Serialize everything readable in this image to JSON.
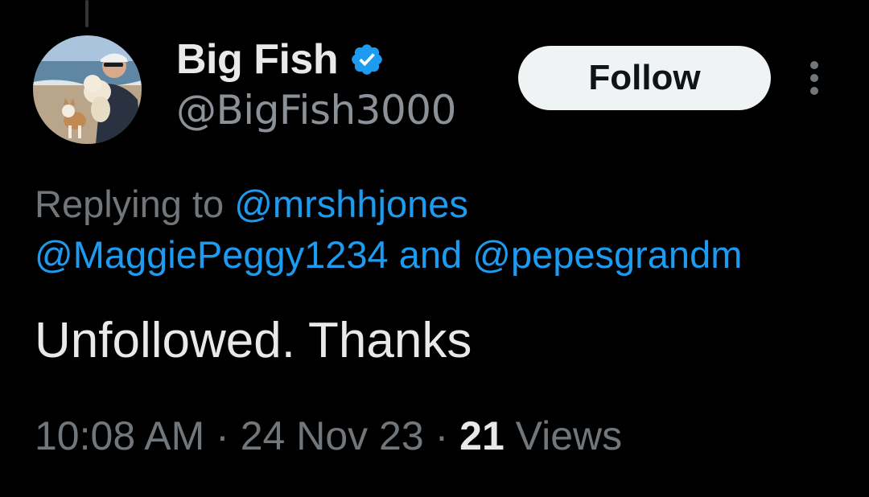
{
  "tweet": {
    "author": {
      "display_name": "Big Fish",
      "handle": "@BigFish3000",
      "verified_icon": "verified-badge-icon",
      "avatar": "profile photo: man with cap holding a small white dog and a tan dog on a beach"
    },
    "follow_button_label": "Follow",
    "more_menu_icon": "more-vertical-icon",
    "reply_context": {
      "prefix": "Replying to",
      "mention_1": "@mrshhjones",
      "mention_2": "@MaggiePeggy1234",
      "connector": "and",
      "mention_3": "@pepesgrandm"
    },
    "text": "Unfollowed. Thanks",
    "meta": {
      "time": "10:08 AM",
      "separator": "·",
      "date": "24 Nov 23",
      "views_count": "21",
      "views_label": "Views"
    }
  },
  "colors": {
    "background": "#000000",
    "primary_text": "#e7e9ea",
    "secondary_text": "#71767b",
    "link": "#1d9bf0",
    "verified": "#1d9bf0",
    "follow_button_bg": "#eff3f4",
    "follow_button_text": "#0f1419"
  }
}
